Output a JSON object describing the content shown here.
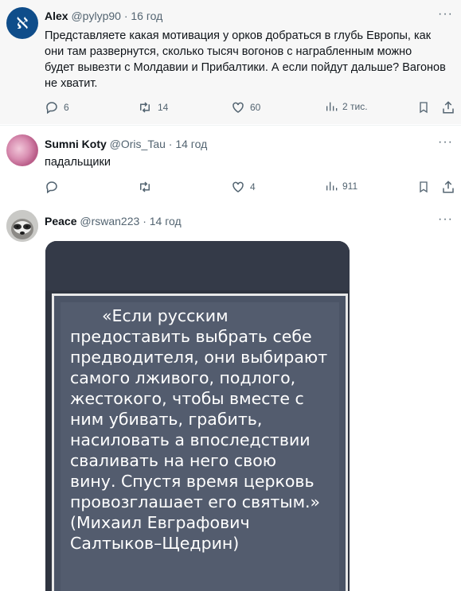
{
  "tweets": [
    {
      "name": "Alex",
      "handle": "@pylyp90",
      "time": "· 16 год",
      "text_lines": [
        "Представляете какая мотивация у орков добраться в глубь Европы, как",
        "они там развернутся, сколько тысяч вогонов с награбленным можно",
        "будет вывезти с Молдавии и Прибалтики. А если пойдут дальше? Вагонов",
        "не хватит."
      ],
      "replies": "6",
      "retweets": "14",
      "likes": "60",
      "views": "2 тис.",
      "avatar_letter": "ℵ",
      "avatar_color": "#0f4d8a"
    },
    {
      "name": "Sumni Koty",
      "handle": "@Oris_Tau",
      "time": "· 14 год",
      "text_lines": [
        "падальщики"
      ],
      "replies": "",
      "retweets": "",
      "likes": "4",
      "views": "911"
    },
    {
      "name": "Peace",
      "handle": "@rswan223",
      "time": "· 14 год",
      "quote_lines": [
        "«Если русским",
        "предоставить выбрать себе",
        "предводителя, они выбирают",
        "самого лживого, подлого,",
        "жестокого, чтобы вместе с",
        "ним убивать, грабить,",
        "насиловать а впоследствии",
        "сваливать на него свою",
        "вину. Спустя время церковь",
        "провозглашает его святым.»",
        "(Михаил Евграфович",
        "Салтыков–Щедрин)"
      ]
    }
  ],
  "more_label": "···"
}
